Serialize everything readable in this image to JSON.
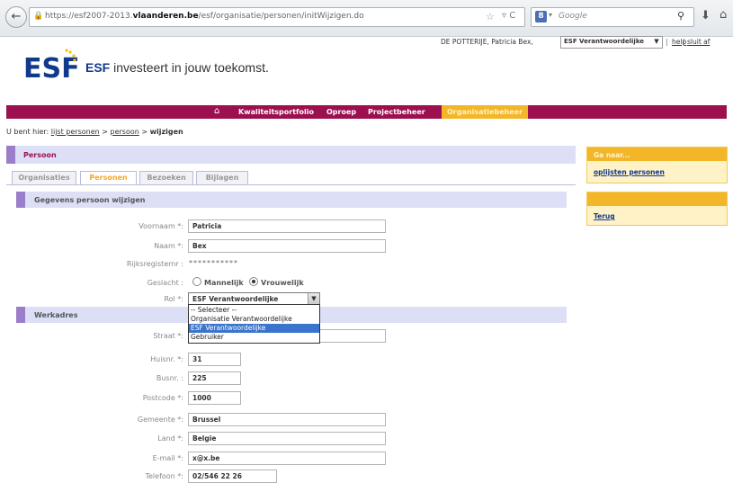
{
  "browser": {
    "url_prefix": "https://esf2007-2013.",
    "url_domain": "vlaanderen.be",
    "url_path": "/esf/organisatie/personen/initWijzigen.do",
    "search_placeholder": "Google",
    "search_engine_glyph": "8"
  },
  "header": {
    "slogan_brand": "ESF",
    "slogan_rest": " investeert in jouw toekomst.",
    "user_name": "DE POTTERIJE,  Patricia Bex,",
    "role_value": "ESF Verantwoordelijke",
    "help_label": "help",
    "logout_label": "sluit af",
    "separator": "|"
  },
  "nav": {
    "items": [
      "Kwaliteitsportfolio",
      "Oproep",
      "Projectbeheer"
    ],
    "active": "Organisatiebeheer"
  },
  "breadcrumb": {
    "prefix": "U bent hier:",
    "links": [
      "lijst personen",
      "persoon"
    ],
    "sep": ">",
    "current": "wijzigen"
  },
  "main": {
    "title": "Persoon",
    "tabs": [
      "Organisaties",
      "Personen",
      "Bezoeken",
      "Bijlagen"
    ],
    "section1_title": "Gegevens persoon wijzigen",
    "section2_title": "Werkadres",
    "fields": {
      "voornaam": {
        "label": "Voornaam *:",
        "value": "Patricia"
      },
      "naam": {
        "label": "Naam *:",
        "value": "Bex"
      },
      "rijksregister": {
        "label": "Rijksregisternr :",
        "value": "***********"
      },
      "geslacht": {
        "label": "Geslacht :",
        "options": [
          "Mannelijk",
          "Vrouwelijk"
        ],
        "selected": "Vrouwelijk"
      },
      "rol": {
        "label": "Rol *:",
        "value": "ESF Verantwoordelijke",
        "options": [
          "-- Selecteer --",
          "Organisatie Verantwoordelijke",
          "ESF Verantwoordelijke",
          "Gebruiker"
        ]
      },
      "straat": {
        "label": "Straat *:",
        "value": ""
      },
      "huisnr": {
        "label": "Huisnr. *:",
        "value": "31"
      },
      "busnr": {
        "label": "Busnr. :",
        "value": "225"
      },
      "postcode": {
        "label": "Postcode *:",
        "value": "1000"
      },
      "gemeente": {
        "label": "Gemeente *:",
        "value": "Brussel"
      },
      "land": {
        "label": "Land *:",
        "value": "Belgie"
      },
      "email": {
        "label": "E-mail *:",
        "value": "x@x.be"
      },
      "telefoon": {
        "label": "Telefoon *:",
        "value": "02/546 22 26"
      }
    }
  },
  "side": {
    "panel1_title": "Ga naar...",
    "panel1_link": "oplijsten personen",
    "panel2_link": "Terug"
  },
  "colors": {
    "nav_bg": "#9c104f",
    "nav_active": "#f3b629",
    "section_bg": "#dcdff5",
    "section_bar": "#9a7ec9",
    "link": "#123a8c"
  }
}
